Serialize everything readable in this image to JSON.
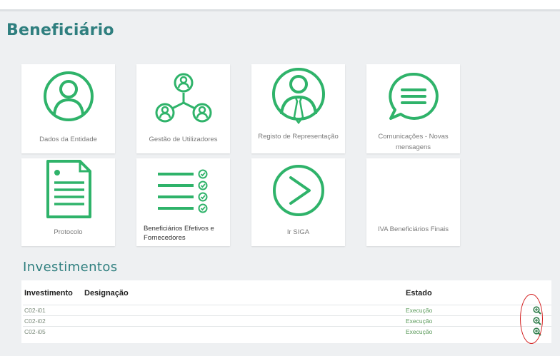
{
  "page": {
    "title": "Beneficiário"
  },
  "tiles": [
    {
      "label": "Dados da Entidade",
      "icon": "user-circle-icon"
    },
    {
      "label": "Gestão de Utilizadores",
      "icon": "users-network-icon"
    },
    {
      "label": "Registo de Representação",
      "icon": "user-tie-icon"
    },
    {
      "label": "Comunicações - Novas mensagens",
      "icon": "chat-bubble-icon"
    },
    {
      "label": "Protocolo",
      "icon": "document-icon"
    },
    {
      "label": "Beneficiários Efetivos e Fornecedores",
      "icon": "checklist-icon"
    },
    {
      "label": "Ir SIGA",
      "icon": "arrow-circle-icon"
    },
    {
      "label": "IVA Beneficiários Finais",
      "icon": ""
    }
  ],
  "investimentos": {
    "title": "Investimentos",
    "columns": {
      "investimento": "Investimento",
      "designacao": "Designação",
      "estado": "Estado"
    },
    "rows": [
      {
        "investimento": "C02-i01",
        "designacao": "",
        "estado": "Execução",
        "action_icon": "zoom-in-icon"
      },
      {
        "investimento": "C02-i02",
        "designacao": "",
        "estado": "Execução",
        "action_icon": "zoom-in-icon"
      },
      {
        "investimento": "C02-i05",
        "designacao": "",
        "estado": "Execução",
        "action_icon": "zoom-in-icon"
      }
    ]
  },
  "colors": {
    "accent": "#2fb36a",
    "title": "#2f7f7f",
    "highlight": "#d42020"
  }
}
